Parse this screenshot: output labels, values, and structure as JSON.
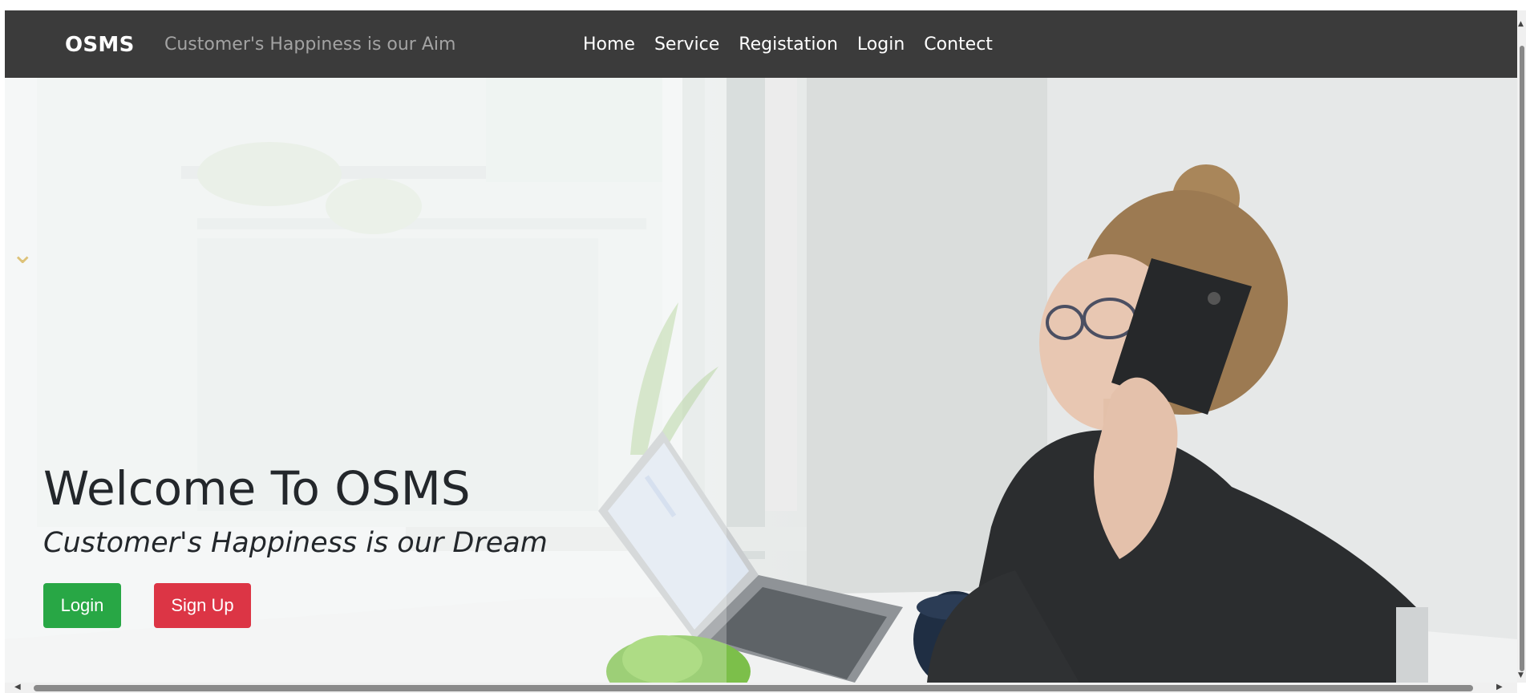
{
  "navbar": {
    "brand": "OSMS",
    "tagline": "Customer's Happiness is our Aim",
    "links": [
      "Home",
      "Service",
      "Registation",
      "Login",
      "Contect"
    ]
  },
  "hero": {
    "title": "Welcome To OSMS",
    "subtitle": "Customer's Happiness is our Dream",
    "login_label": "Login",
    "signup_label": "Sign Up"
  },
  "colors": {
    "navbar_bg": "#3b3b3b",
    "login_btn": "#28a745",
    "signup_btn": "#dc3545"
  }
}
